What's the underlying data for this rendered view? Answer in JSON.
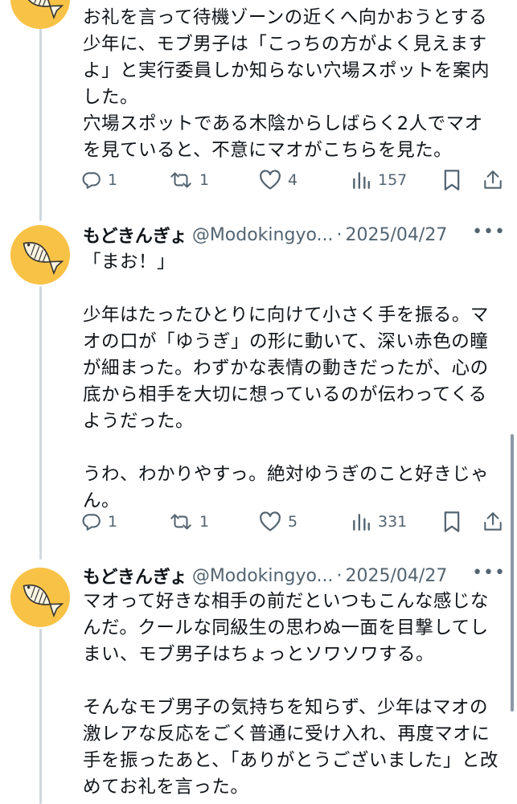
{
  "posts": [
    {
      "name": "",
      "handle": "",
      "date": "",
      "text": "お礼を言って待機ゾーンの近くへ向かおうとする少年に、モブ男子は「こっちの方がよく見えますよ」と実行委員しか知らない穴場スポットを案内した。\n穴場スポットである木陰からしばらく2人でマオを見ていると、不意にマオがこちらを見た。",
      "replies": "1",
      "reposts": "1",
      "likes": "4",
      "views": "157"
    },
    {
      "name": "もどきんぎょ",
      "handle": "@Modokingyo...",
      "separator": "·",
      "date": "2025/04/27",
      "text": "「まお！」\n\n少年はたったひとりに向けて小さく手を振る。マオの口が「ゆうぎ」の形に動いて、深い赤色の瞳が細まった。わずかな表情の動きだったが、心の底から相手を大切に想っているのが伝わってくるようだった。\n\nうわ、わかりやすっ。絶対ゆうぎのこと好きじゃん。",
      "replies": "1",
      "reposts": "1",
      "likes": "5",
      "views": "331"
    },
    {
      "name": "もどきんぎょ",
      "handle": "@Modokingyo...",
      "separator": "·",
      "date": "2025/04/27",
      "text": "マオって好きな相手の前だといつもこんな感じなんだ。クールな同級生の思わぬ一面を目撃してしまい、モブ男子はちょっとソワソワする。\n\nそんなモブ男子の気持ちを知らず、少年はマオの激レアな反応をごく普通に受け入れ、再度マオに手を振ったあと、「ありがとうございました」と改めてお礼を言った。"
    }
  ],
  "icons": {
    "reply": "reply-icon",
    "repost": "repost-icon",
    "like": "heart-icon",
    "views": "views-icon",
    "bookmark": "bookmark-icon",
    "share": "share-icon",
    "more": "more-icon"
  },
  "colors": {
    "avatar_bg": "#f8c246",
    "secondary_text": "#536471",
    "thread_line": "#cfd9de"
  }
}
